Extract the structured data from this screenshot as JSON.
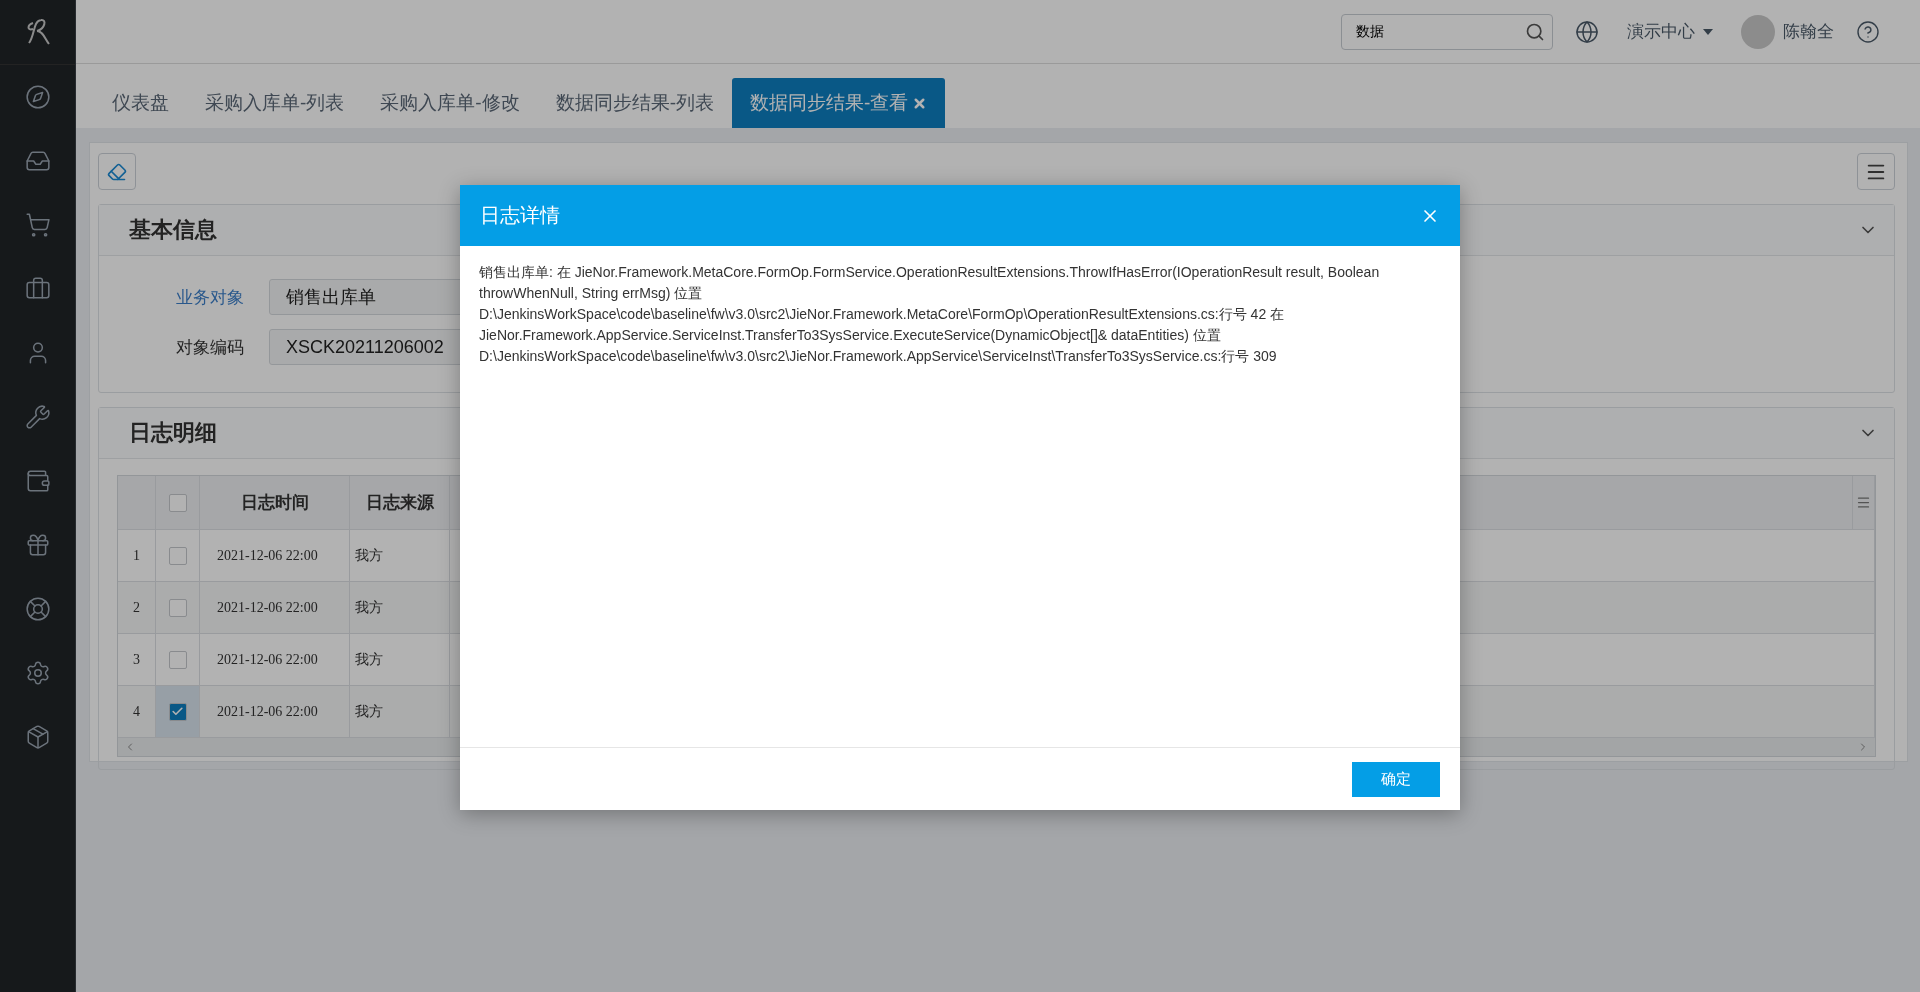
{
  "header": {
    "search": {
      "value": "数据"
    },
    "org_menu": {
      "label": "演示中心"
    },
    "user": {
      "name": "陈翰全"
    }
  },
  "tabs": [
    {
      "label": "仪表盘",
      "selected": false
    },
    {
      "label": "采购入库单-列表",
      "selected": false
    },
    {
      "label": "采购入库单-修改",
      "selected": false
    },
    {
      "label": "数据同步结果-列表",
      "selected": false
    },
    {
      "label": "数据同步结果-查看",
      "selected": true
    }
  ],
  "basic_info": {
    "title": "基本信息",
    "fields": [
      {
        "label": "业务对象",
        "value": "销售出库单",
        "kind": "link"
      },
      {
        "label": "对象编码",
        "value": "XSCK20211206002",
        "kind": "plain"
      }
    ]
  },
  "log_detail": {
    "title": "日志明细",
    "table": {
      "columns": [
        "日志时间",
        "日志来源"
      ],
      "header_checkbox": {
        "checked": false
      },
      "rows": [
        {
          "index": "1",
          "checked": false,
          "cells": [
            "2021-12-06 22:00",
            "我方"
          ]
        },
        {
          "index": "2",
          "checked": false,
          "cells": [
            "2021-12-06 22:00",
            "我方"
          ]
        },
        {
          "index": "3",
          "checked": false,
          "cells": [
            "2021-12-06 22:00",
            "我方"
          ]
        },
        {
          "index": "4",
          "checked": true,
          "cells": [
            "2021-12-06 22:00",
            "我方"
          ]
        }
      ]
    }
  },
  "dialog": {
    "title": "日志详情",
    "message": "销售出库单: 在 JieNor.Framework.MetaCore.FormOp.FormService.OperationResultExtensions.ThrowIfHasError(IOperationResult result, Boolean throwWhenNull, String errMsg) 位置 D:\\JenkinsWorkSpace\\code\\baseline\\fw\\v3.0\\src2\\JieNor.Framework.MetaCore\\FormOp\\OperationResultExtensions.cs:行号 42 在 JieNor.Framework.AppService.ServiceInst.TransferTo3SysService.ExecuteService(DynamicObject[]& dataEntities) 位置 D:\\JenkinsWorkSpace\\code\\baseline\\fw\\v3.0\\src2\\JieNor.Framework.AppService\\ServiceInst\\TransferTo3SysService.cs:行号 309",
    "buttons": [
      {
        "label": "确定"
      }
    ]
  }
}
